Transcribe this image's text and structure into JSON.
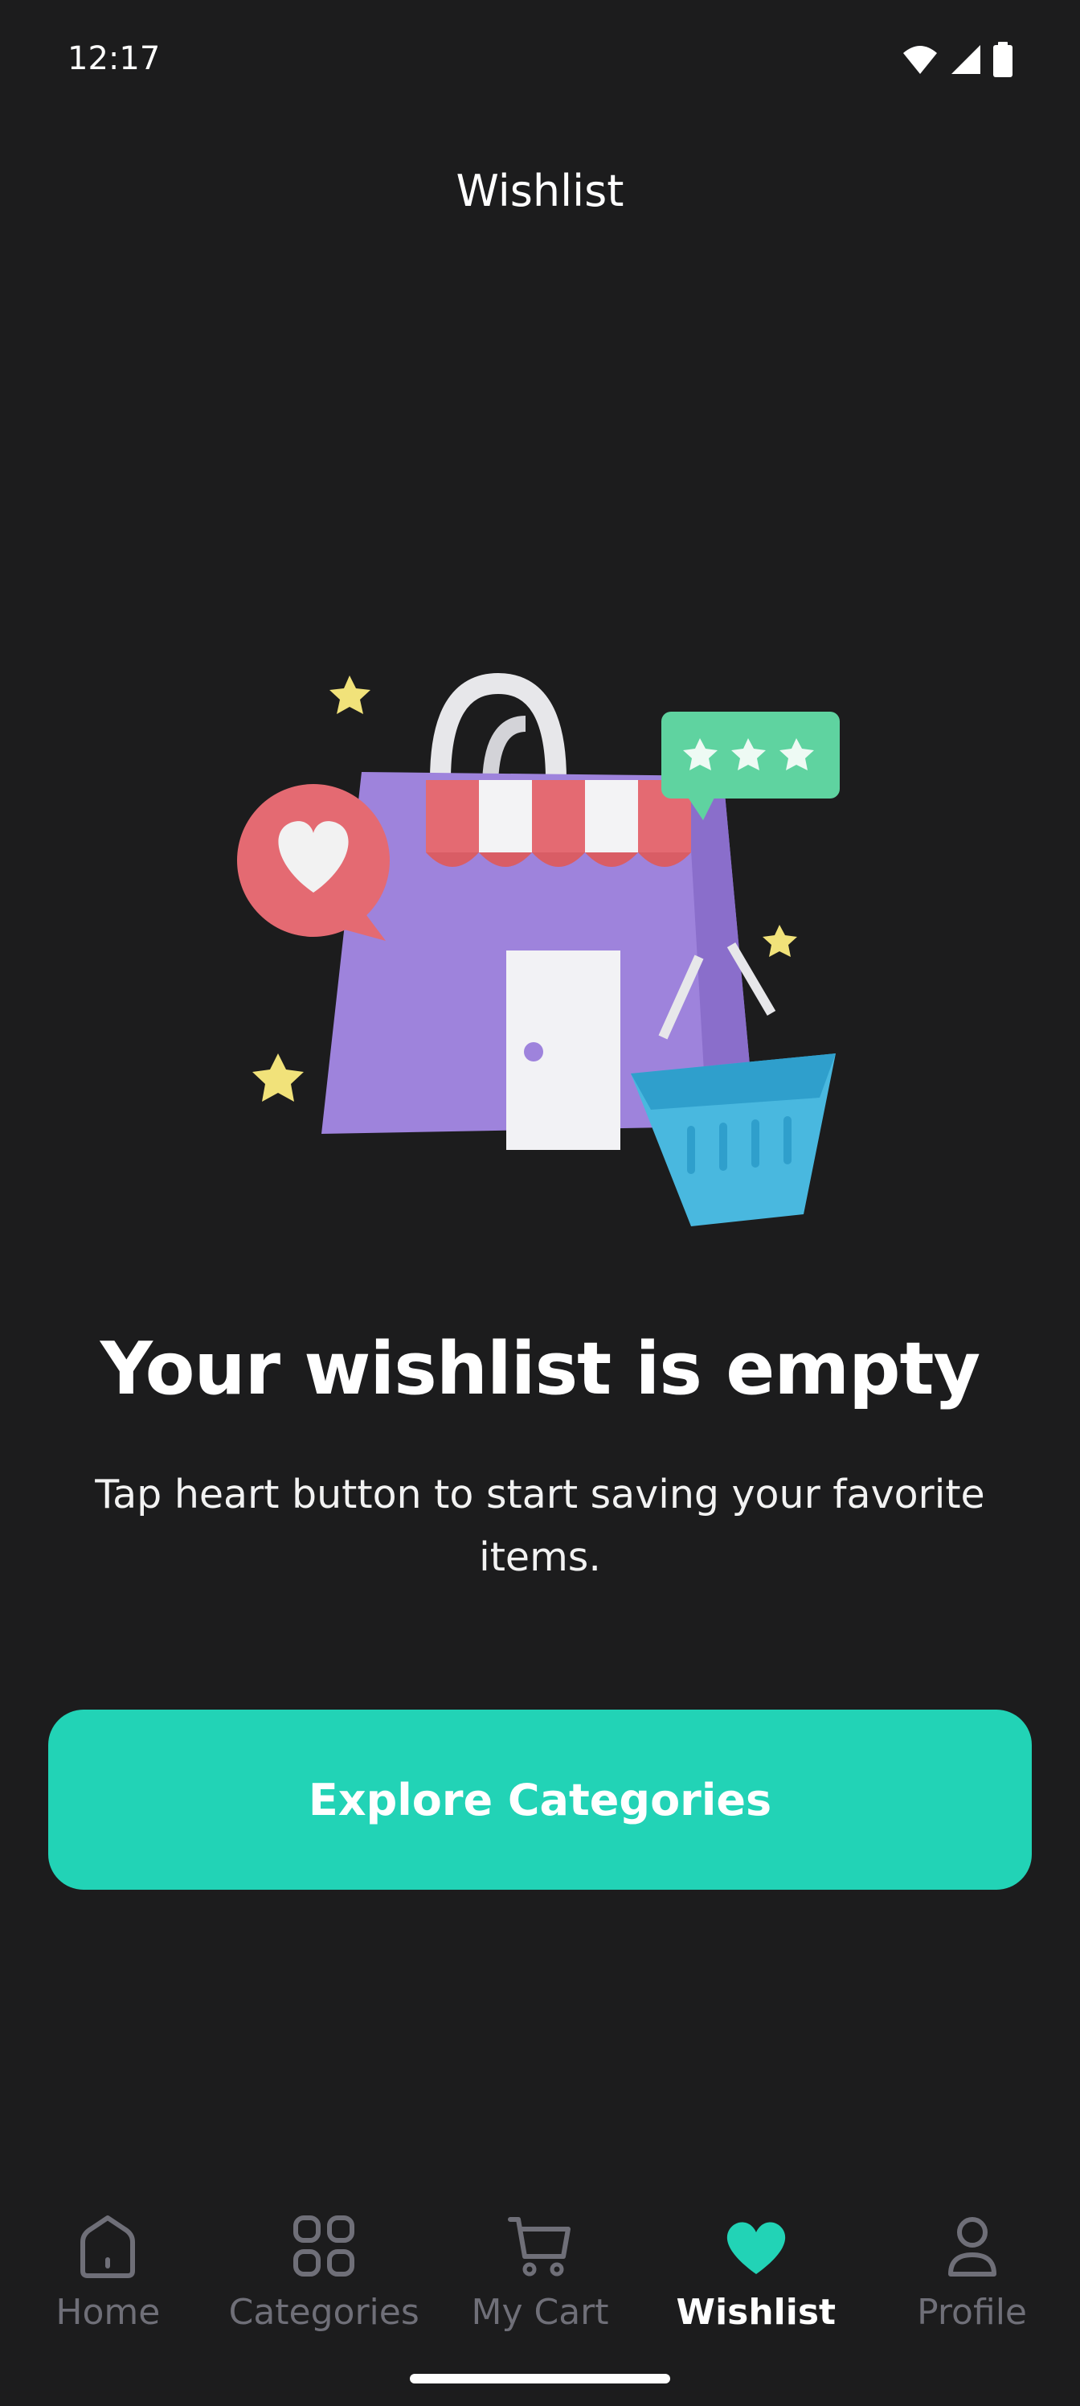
{
  "status_bar": {
    "time": "12:17",
    "icons": [
      "wifi-icon",
      "signal-icon",
      "battery-icon"
    ]
  },
  "header": {
    "title": "Wishlist"
  },
  "empty_state": {
    "illustration": "shopping-store-illustration",
    "title": "Your wishlist is empty",
    "message": "Tap heart button to start saving your favorite items.",
    "button_label": "Explore Categories"
  },
  "bottom_nav": {
    "items": [
      {
        "label": "Home",
        "icon": "home-icon",
        "active": false
      },
      {
        "label": "Categories",
        "icon": "grid-icon",
        "active": false
      },
      {
        "label": "My Cart",
        "icon": "cart-icon",
        "active": false
      },
      {
        "label": "Wishlist",
        "icon": "heart-icon",
        "active": true
      },
      {
        "label": "Profile",
        "icon": "person-icon",
        "active": false
      }
    ]
  },
  "colors": {
    "background": "#1c1c1d",
    "accent": "#22d3b6",
    "inactive": "#6f6f78",
    "text": "#ffffff"
  }
}
